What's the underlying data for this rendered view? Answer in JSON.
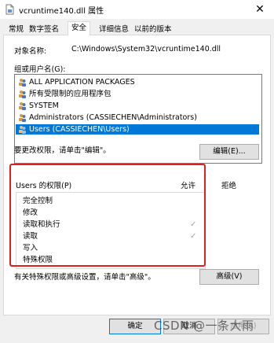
{
  "window": {
    "title": "vcruntime140.dll 属性",
    "close_glyph": "✕"
  },
  "tabs": [
    "常规",
    "数字签名",
    "安全",
    "详细信息",
    "以前的版本"
  ],
  "active_tab_index": 2,
  "object": {
    "label": "对象名称:",
    "value": "C:\\Windows\\System32\\vcruntime140.dll"
  },
  "groups": {
    "label": "组或用户名(G):",
    "items": [
      {
        "label": "ALL APPLICATION PACKAGES",
        "icon": "group-icon"
      },
      {
        "label": "所有受限制的应用程序包",
        "icon": "group-icon"
      },
      {
        "label": "SYSTEM",
        "icon": "group-icon"
      },
      {
        "label": "Administrators (CASSIECHEN\\Administrators)",
        "icon": "group-icon"
      },
      {
        "label": "Users (CASSIECHEN\\Users)",
        "icon": "group-icon",
        "selected": true
      }
    ]
  },
  "edit_hint": "要更改权限，请单击\"编辑\"。",
  "edit_button": "编辑(E)...",
  "permissions": {
    "header": "Users 的权限(P)",
    "allow_col": "允许",
    "deny_col": "拒绝",
    "rows": [
      {
        "name": "完全控制",
        "allow": false
      },
      {
        "name": "修改",
        "allow": false
      },
      {
        "name": "读取和执行",
        "allow": true
      },
      {
        "name": "读取",
        "allow": true
      },
      {
        "name": "写入",
        "allow": false
      },
      {
        "name": "特殊权限",
        "allow": false
      }
    ],
    "check_glyph": "✓"
  },
  "advanced_hint": "有关特殊权限或高级设置，请单击\"高级\"。",
  "advanced_button": "高级(V)",
  "footer": {
    "ok": "确定",
    "cancel": "取消",
    "apply": "应用(A)"
  },
  "watermark": "CSDN @一条大雨",
  "colors": {
    "selection": "#0078d7",
    "highlight_border": "#e02020"
  }
}
